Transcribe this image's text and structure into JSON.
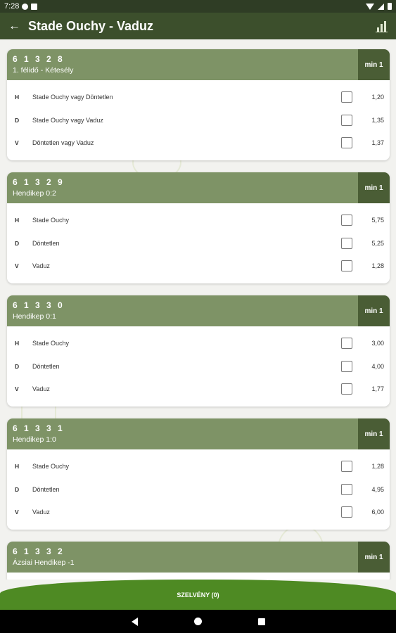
{
  "status_bar": {
    "time": "7:28"
  },
  "app_bar": {
    "title": "Stade Ouchy - Vaduz"
  },
  "cards": [
    {
      "code": "6 1 3 2 8",
      "subtitle": "1. félidő - Kétesély",
      "min": "min 1",
      "rows": [
        {
          "letter": "H",
          "label": "Stade Ouchy vagy Döntetlen",
          "odds": "1,20"
        },
        {
          "letter": "D",
          "label": "Stade Ouchy vagy Vaduz",
          "odds": "1,35"
        },
        {
          "letter": "V",
          "label": "Döntetlen vagy Vaduz",
          "odds": "1,37"
        }
      ]
    },
    {
      "code": "6 1 3 2 9",
      "subtitle": "Hendikep 0:2",
      "min": "min 1",
      "rows": [
        {
          "letter": "H",
          "label": "Stade Ouchy",
          "odds": "5,75"
        },
        {
          "letter": "D",
          "label": "Döntetlen",
          "odds": "5,25"
        },
        {
          "letter": "V",
          "label": "Vaduz",
          "odds": "1,28"
        }
      ]
    },
    {
      "code": "6 1 3 3 0",
      "subtitle": "Hendikep 0:1",
      "min": "min 1",
      "rows": [
        {
          "letter": "H",
          "label": "Stade Ouchy",
          "odds": "3,00"
        },
        {
          "letter": "D",
          "label": "Döntetlen",
          "odds": "4,00"
        },
        {
          "letter": "V",
          "label": "Vaduz",
          "odds": "1,77"
        }
      ]
    },
    {
      "code": "6 1 3 3 1",
      "subtitle": "Hendikep 1:0",
      "min": "min 1",
      "rows": [
        {
          "letter": "H",
          "label": "Stade Ouchy",
          "odds": "1,28"
        },
        {
          "letter": "D",
          "label": "Döntetlen",
          "odds": "4,95"
        },
        {
          "letter": "V",
          "label": "Vaduz",
          "odds": "6,00"
        }
      ]
    },
    {
      "code": "6 1 3 3 2",
      "subtitle": "Ázsiai Hendikep -1",
      "min": "min 1",
      "rows": []
    }
  ],
  "bottom_button": {
    "label": "SZELVÉNY (0)"
  },
  "colors": {
    "app_bar": "#3c4f2c",
    "card_header": "#7e9366",
    "badge": "#4a5d35",
    "bottom_button": "#4e8a23"
  }
}
